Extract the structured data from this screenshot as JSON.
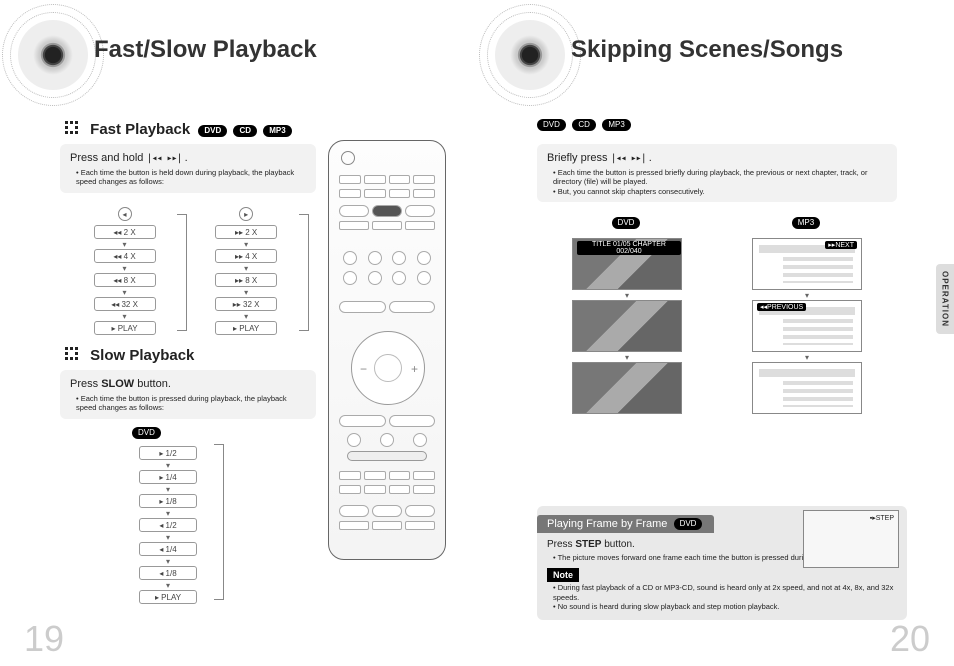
{
  "left": {
    "title": "Fast/Slow Playback",
    "fast": {
      "heading": "Fast Playback",
      "badges": [
        "DVD",
        "CD",
        "MP3"
      ],
      "lead_pre": "Press and hold ",
      "lead_post": " .",
      "bullet": "Each time the button is held down during playback, the playback speed changes as follows:",
      "rev": [
        "◂◂  2 X",
        "◂◂  4 X",
        "◂◂  8 X",
        "◂◂  32 X",
        "▸  PLAY"
      ],
      "fwd": [
        "▸▸  2 X",
        "▸▸  4 X",
        "▸▸  8 X",
        "▸▸  32 X",
        "▸  PLAY"
      ]
    },
    "slow": {
      "heading": "Slow Playback",
      "lead_pre": "Press  ",
      "lead_bold": "SLOW",
      "lead_post": " button.",
      "bullet": "Each time the button is pressed during playback, the playback speed changes as follows:",
      "badge": "DVD",
      "steps": [
        "▸  1/2",
        "▸  1/4",
        "▸  1/8",
        "◂  1/2",
        "◂  1/4",
        "◂  1/8",
        "▸  PLAY"
      ]
    },
    "page_num": "19"
  },
  "right": {
    "title": "Skipping Scenes/Songs",
    "badges": [
      "DVD",
      "CD",
      "MP3"
    ],
    "lead_pre": "Briefly press ",
    "lead_post": " .",
    "bullets": [
      "Each time the button is pressed briefly during playback, the previous or next chapter, track, or directory (file) will be played.",
      "But, you cannot skip chapters consecutively."
    ],
    "col_dvd": "DVD",
    "col_mp3": "MP3",
    "dvd_tag": "TITLE 01/05  CHAPTER 002/040",
    "mp3_next": "▸▸NEXT",
    "mp3_prev": "◂◂PREVIOUS",
    "frame": {
      "title": "Playing Frame by Frame",
      "badge": "DVD",
      "lead_pre": "Press ",
      "lead_bold": "STEP",
      "lead_post": " button.",
      "bullet": "The picture moves forward one frame each time the button is pressed during playback.",
      "note_label": "Note",
      "notes": [
        "During fast playback of a CD or MP3-CD, sound is heard only at 2x speed, and not at 4x, 8x, and 32x speeds.",
        "No sound is heard during slow playback and step motion playback."
      ],
      "thumb_tag": "▪▸STEP"
    },
    "side_tab": "OPERATION",
    "page_num": "20"
  }
}
